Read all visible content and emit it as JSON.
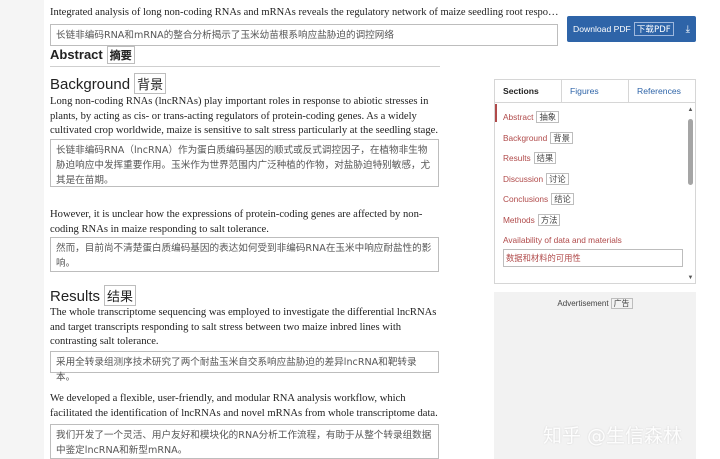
{
  "article": {
    "title": "Integrated analysis of long non-coding RNAs and mRNAs reveals the regulatory network of maize seedling root respondin...",
    "title_translation": "长链非编码RNA和mRNA的整合分析揭示了玉米幼苗根系响应盐胁迫的调控网络",
    "abstract_heading": "Abstract",
    "abstract_heading_zh": "摘要"
  },
  "download": {
    "label": "Download PDF",
    "label_zh": "下载PDF",
    "icon": "download-arrow-icon",
    "color": "#2e64a8"
  },
  "sections": [
    {
      "heading": "Background",
      "heading_zh": "背景",
      "paragraphs": [
        {
          "text": "Long non-coding RNAs (lncRNAs) play important roles in response to abiotic stresses in plants, by acting as cis- or trans-acting regulators of protein-coding genes. As a widely cultivated crop worldwide, maize is sensitive to salt stress particularly at the seedling stage.",
          "translation": "长链非编码RNA（lncRNA）作为蛋白质编码基因的顺式或反式调控因子，在植物非生物胁迫响应中发挥重要作用。玉米作为世界范围内广泛种植的作物，对盐胁迫特别敏感，尤其是在苗期。"
        },
        {
          "text": "However, it is unclear how the expressions of protein-coding genes are affected by non-coding RNAs in maize responding to salt tolerance.",
          "translation": "然而，目前尚不清楚蛋白质编码基因的表达如何受到非编码RNA在玉米中响应耐盐性的影响。"
        }
      ]
    },
    {
      "heading": "Results",
      "heading_zh": "结果",
      "paragraphs": [
        {
          "text": "The whole transcriptome sequencing was employed to investigate the differential lncRNAs and target transcripts responding to salt stress between two maize inbred lines with contrasting salt tolerance.",
          "translation": "采用全转录组测序技术研究了两个耐盐玉米自交系响应盐胁迫的差异lncRNA和靶转录本。"
        },
        {
          "text": "We developed a flexible, user-friendly, and modular RNA analysis workflow, which facilitated the identification of lncRNAs and novel mRNAs from whole transcriptome data.",
          "translation": "我们开发了一个灵活、用户友好和模块化的RNA分析工作流程，有助于从整个转录组数据中鉴定lncRNA和新型mRNA。"
        }
      ]
    }
  ],
  "sidebar": {
    "tabs": [
      "Sections",
      "Figures",
      "References"
    ],
    "active_tab": "Sections",
    "items": [
      {
        "label": "Abstract",
        "zh": "抽象"
      },
      {
        "label": "Background",
        "zh": "背景"
      },
      {
        "label": "Results",
        "zh": "结果"
      },
      {
        "label": "Discussion",
        "zh": "讨论"
      },
      {
        "label": "Conclusions",
        "zh": "结论"
      },
      {
        "label": "Methods",
        "zh": "方法"
      },
      {
        "label": "Availability of data and materials",
        "zh": "数据和材料的可用性"
      }
    ],
    "link_color": "#b04a4a"
  },
  "ad": {
    "label": "Advertisement",
    "label_zh": "广告"
  },
  "watermark": "知乎 @生信森林"
}
